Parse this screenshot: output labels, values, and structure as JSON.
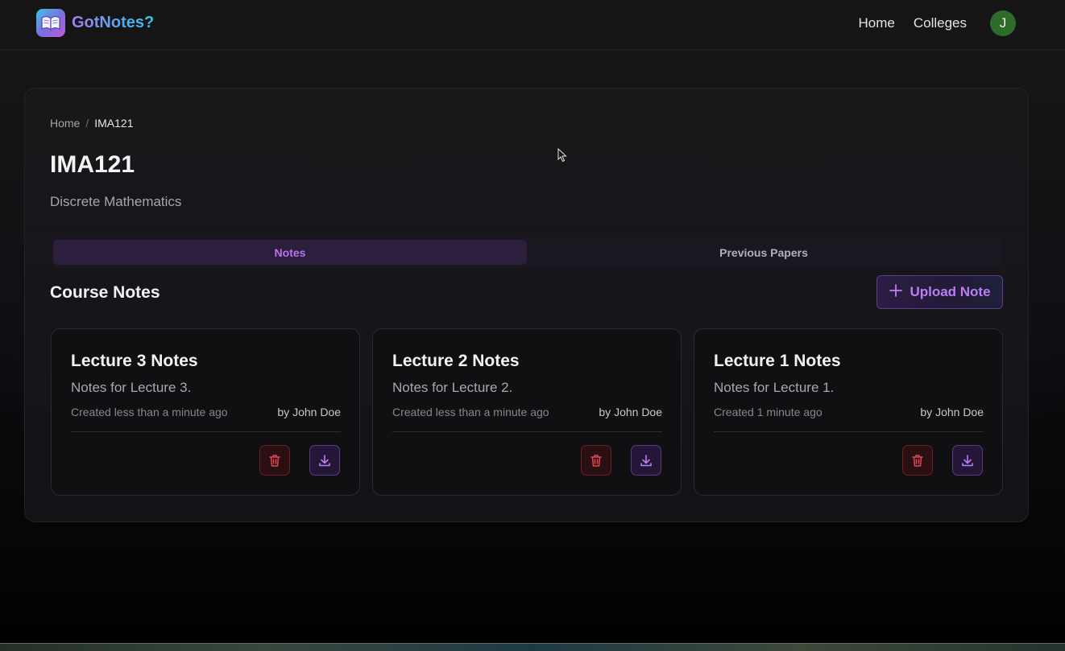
{
  "navbar": {
    "brand": "GotNotes?",
    "links": [
      "Home",
      "Colleges"
    ],
    "avatar_initial": "J"
  },
  "breadcrumb": {
    "home": "Home",
    "separator": "/",
    "current": "IMA121"
  },
  "course": {
    "code": "IMA121",
    "name": "Discrete Mathematics"
  },
  "tabs": [
    {
      "label": "Notes",
      "active": true
    },
    {
      "label": "Previous Papers",
      "active": false
    }
  ],
  "section": {
    "title": "Course Notes",
    "upload_label": "Upload Note"
  },
  "notes": [
    {
      "title": "Lecture 3 Notes",
      "description": "Notes for Lecture 3.",
      "created": "Created less than a minute ago",
      "author": "by John Doe"
    },
    {
      "title": "Lecture 2 Notes",
      "description": "Notes for Lecture 2.",
      "created": "Created less than a minute ago",
      "author": "by John Doe"
    },
    {
      "title": "Lecture 1 Notes",
      "description": "Notes for Lecture 1.",
      "created": "Created 1 minute ago",
      "author": "by John Doe"
    }
  ],
  "icons": {
    "logo": "open-book-icon",
    "upload": "plus-icon",
    "delete": "trash-icon",
    "download": "download-icon"
  },
  "colors": {
    "accent": "#b874ef",
    "danger": "#e0474f",
    "avatar": "#2f6b2b"
  }
}
